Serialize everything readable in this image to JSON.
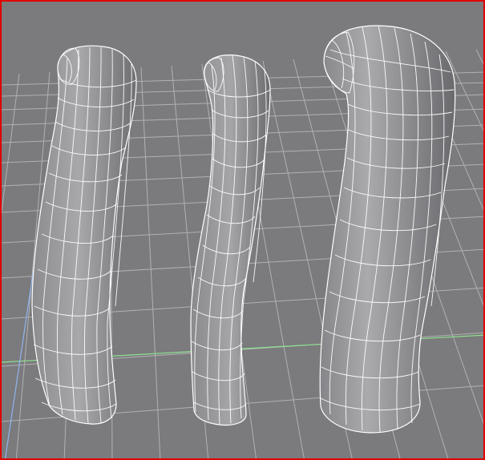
{
  "viewport": {
    "title": "",
    "background_color": "#7b7a7c",
    "border_color": "#e00000",
    "grid_color": "#b7b7ba",
    "axis_x_color": "#8ee08e",
    "axis_z_color": "#8fb6f0",
    "wire_color": "#ffffff"
  },
  "objects": [
    {
      "name": "tube-left"
    },
    {
      "name": "tube-middle"
    },
    {
      "name": "tube-right"
    }
  ]
}
